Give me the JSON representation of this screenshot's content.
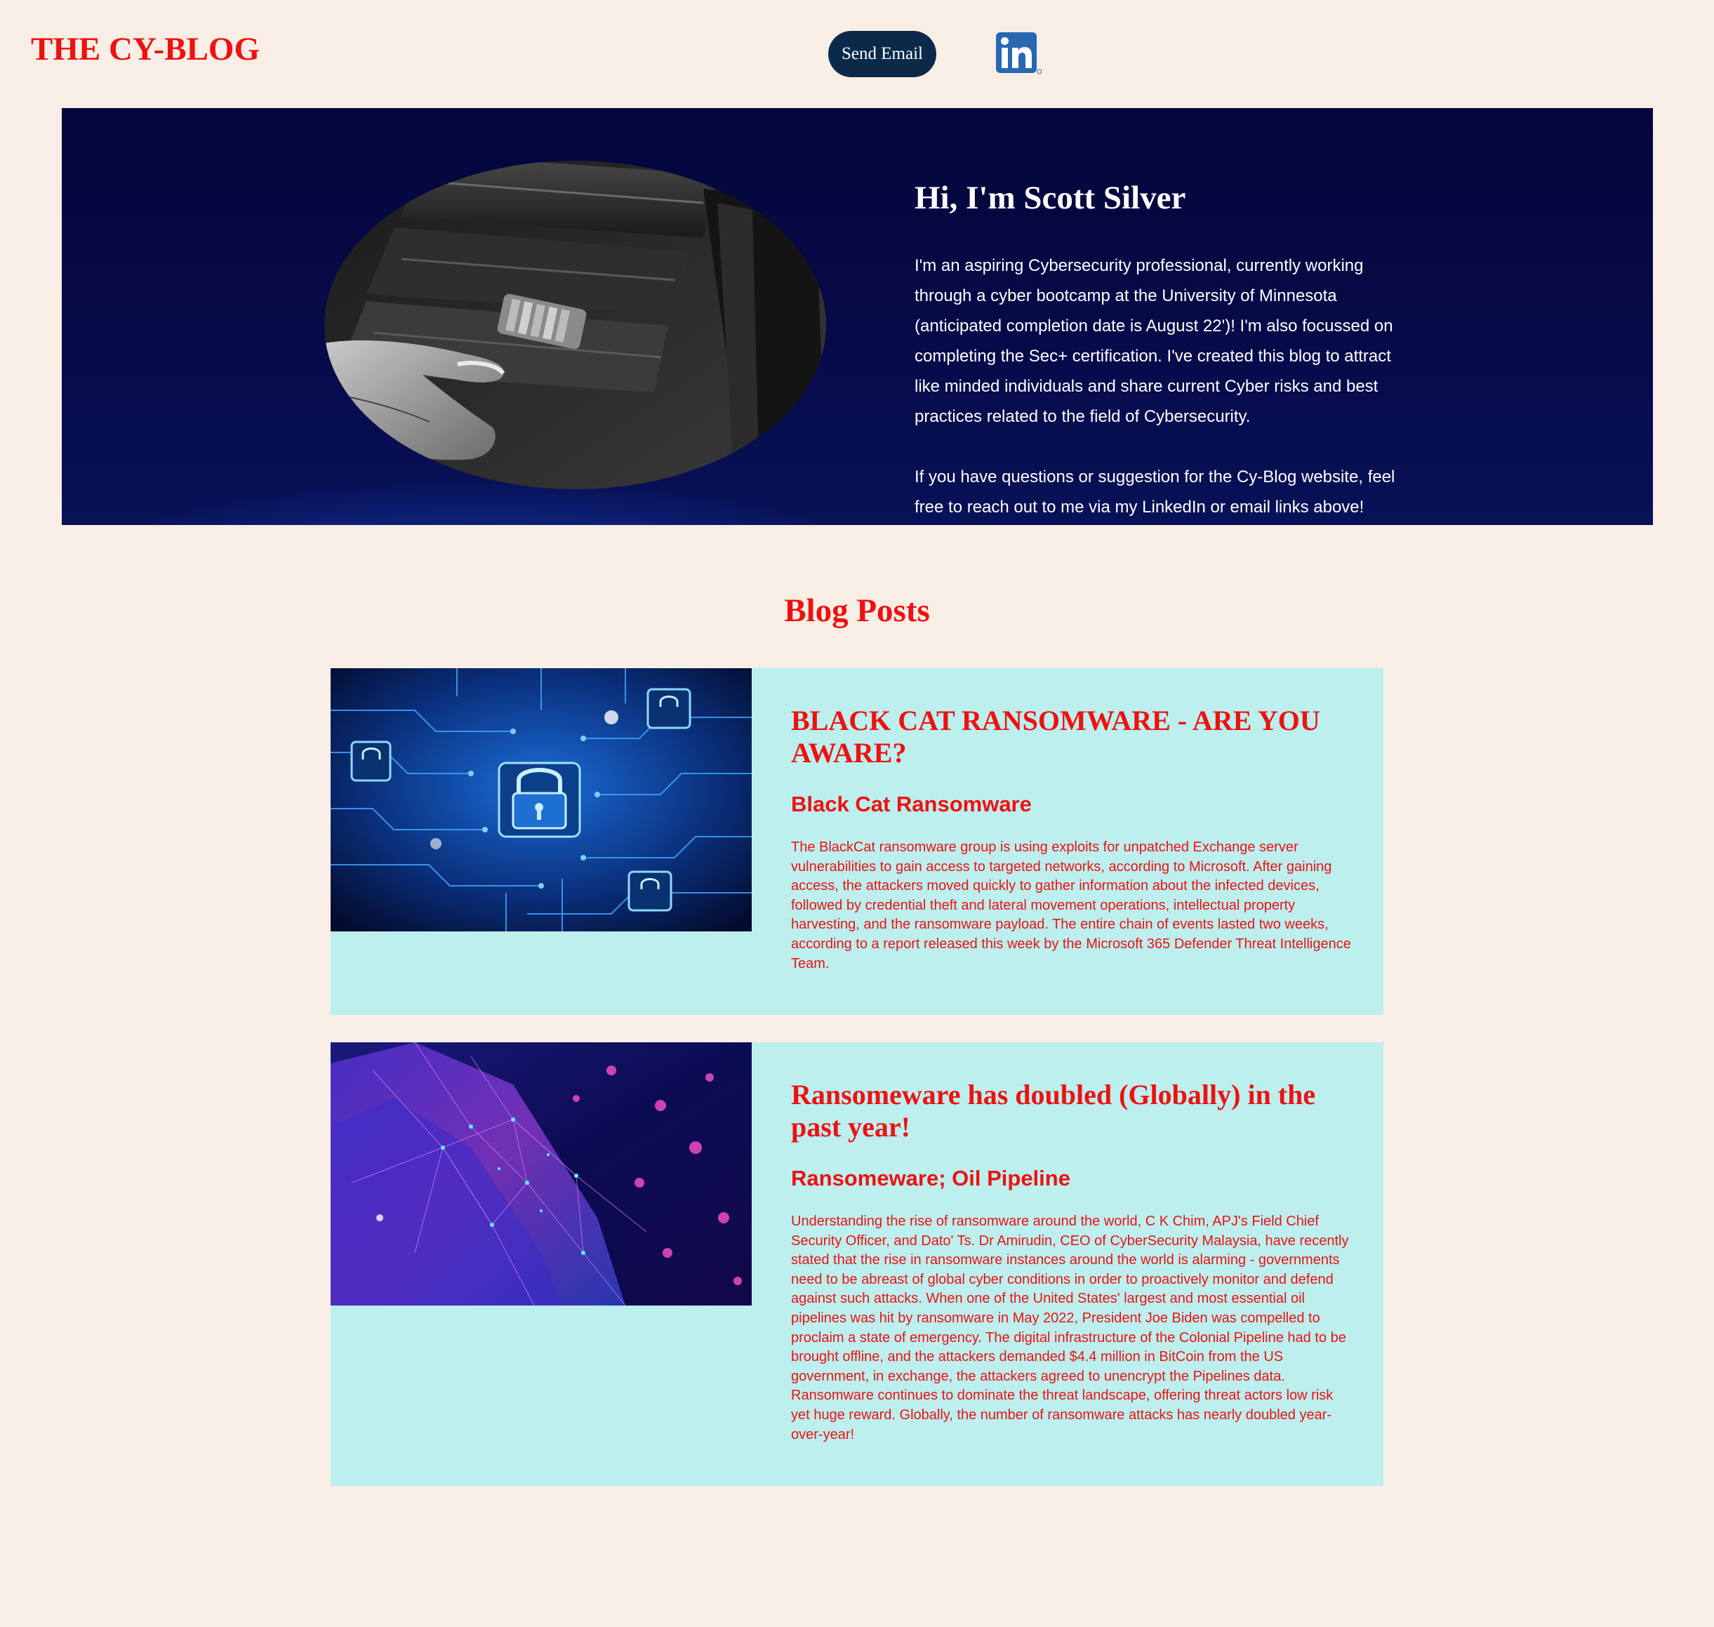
{
  "header": {
    "site_title": "THE CY-BLOG",
    "email_button_label": "Send Email",
    "linkedin_icon": "linkedin-icon"
  },
  "hero": {
    "heading": "Hi, I'm Scott Silver",
    "paragraphs": [
      "I'm an aspiring Cybersecurity professional, currently working through a cyber bootcamp at the University of Minnesota (anticipated completion date is August 22')! I'm also focussed on completing the Sec+ certification. I've created this blog to attract like minded individuals and share current Cyber risks and best practices related to the field of Cybersecurity.",
      "If you have questions or suggestion for the Cy-Blog website, feel free to reach out to me via my LinkedIn or email links above!"
    ],
    "image": "padlock-photo"
  },
  "blog": {
    "heading": "Blog Posts",
    "posts": [
      {
        "title": "BLACK CAT RANSOMWARE - ARE YOU AWARE?",
        "subtitle": "Black Cat Ransomware",
        "text": "The BlackCat ransomware group is using exploits for unpatched Exchange server vulnerabilities to gain access to targeted networks, according to Microsoft. After gaining access, the attackers moved quickly to gather information about the infected devices, followed by credential theft and lateral movement operations, intellectual property harvesting, and the ransomware payload. The entire chain of events lasted two weeks, according to a report released this week by the Microsoft 365 Defender Threat Intelligence Team.",
        "image": "circuit-lock-image"
      },
      {
        "title": "Ransomeware has doubled (Globally) in the past year!",
        "subtitle": "Ransomeware; Oil Pipeline",
        "text": "Understanding the rise of ransomware around the world, C K Chim, APJ's Field Chief Security Officer, and Dato' Ts. Dr Amirudin, CEO of CyberSecurity Malaysia, have recently stated that the rise in ransomware instances around the world is alarming - governments need to be abreast of global cyber conditions in order to proactively monitor and defend against such attacks. When one of the United States' largest and most essential oil pipelines was hit by ransomware in May 2022, President Joe Biden was compelled to proclaim a state of emergency. The digital infrastructure of the Colonial Pipeline had to be brought offline, and the attackers demanded $4.4 million in BitCoin from the US government, in exchange, the attackers agreed to unencrypt the Pipelines data. Ransomware continues to dominate the threat landscape, offering threat actors low risk yet huge reward. Globally, the number of ransomware attacks has nearly doubled year-over-year!",
        "image": "network-mesh-image"
      }
    ]
  },
  "colors": {
    "page_background": "#f8eee5",
    "accent_red": "#ee1111",
    "button_navy": "#0b2a4a",
    "card_background": "#bcefee",
    "linkedin_blue": "#2867b2"
  }
}
